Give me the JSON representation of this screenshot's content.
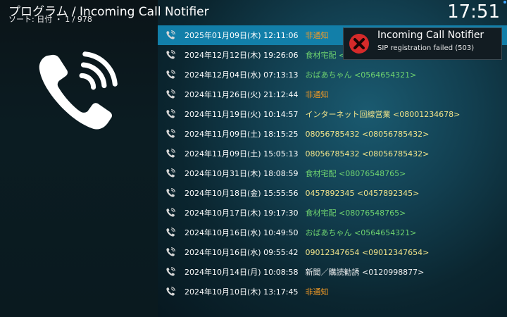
{
  "header": {
    "title": "プログラム / Incoming Call Notifier",
    "subtitle": "ソート: 日付 ・ 1 / 978",
    "clock": "17:51"
  },
  "calls": [
    {
      "date": "2025年01月09日(木) 12:11:06",
      "name": "非通知",
      "date_color": "white",
      "name_color": "orange",
      "selected": true
    },
    {
      "date": "2024年12月12日(木) 19:26:06",
      "name": "食材宅配 <08076548765>",
      "date_color": "white",
      "name_color": "green"
    },
    {
      "date": "2024年12月04日(水) 07:13:13",
      "name": "おばあちゃん <0564654321>",
      "date_color": "white",
      "name_color": "green"
    },
    {
      "date": "2024年11月26日(火) 21:12:44",
      "name": "非通知",
      "date_color": "white",
      "name_color": "orange"
    },
    {
      "date": "2024年11月19日(火) 10:14:57",
      "name": "インターネット回線営業 <08001234678>",
      "date_color": "white",
      "name_color": "yellow"
    },
    {
      "date": "2024年11月09日(土) 18:15:25",
      "name": "08056785432 <08056785432>",
      "date_color": "blue",
      "name_color": "yellow"
    },
    {
      "date": "2024年11月09日(土) 15:05:13",
      "name": "08056785432 <08056785432>",
      "date_color": "blue",
      "name_color": "yellow"
    },
    {
      "date": "2024年10月31日(木) 18:08:59",
      "name": "食材宅配 <08076548765>",
      "date_color": "white",
      "name_color": "green"
    },
    {
      "date": "2024年10月18日(金) 15:55:56",
      "name": "0457892345 <0457892345>",
      "date_color": "white",
      "name_color": "yellow"
    },
    {
      "date": "2024年10月17日(木) 19:17:30",
      "name": "食材宅配 <08076548765>",
      "date_color": "white",
      "name_color": "green"
    },
    {
      "date": "2024年10月16日(水) 10:49:50",
      "name": "おばあちゃん <0564654321>",
      "date_color": "white",
      "name_color": "green"
    },
    {
      "date": "2024年10月16日(水) 09:55:42",
      "name": "09012347654 <09012347654>",
      "date_color": "white",
      "name_color": "yellow"
    },
    {
      "date": "2024年10月14日(月) 10:08:58",
      "name": "新聞／購読勧誘 <0120998877>",
      "date_color": "red",
      "name_color": "white"
    },
    {
      "date": "2024年10月10日(木) 13:17:45",
      "name": "非通知",
      "date_color": "white",
      "name_color": "orange"
    }
  ],
  "toast": {
    "title": "Incoming Call Notifier",
    "message": "SIP registration failed (503)",
    "icon": "error-icon"
  },
  "colors": {
    "selected_row": "#127fa9",
    "orange": "#f29a26",
    "green": "#6fd36f",
    "yellow": "#f2e48a",
    "blue": "#7ec8f0",
    "red": "#e2473a"
  }
}
